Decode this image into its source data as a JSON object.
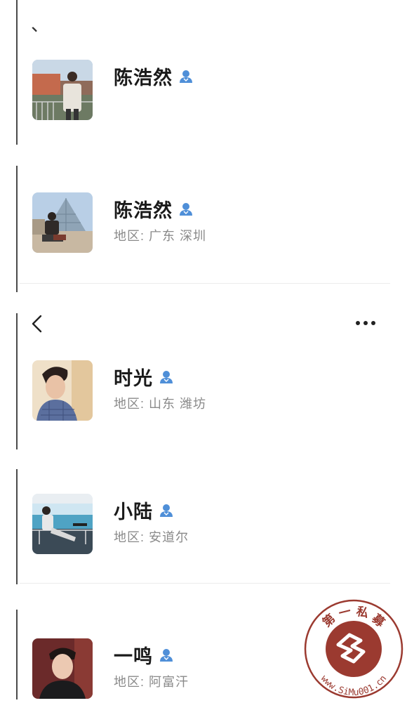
{
  "top_mark": "、",
  "contacts": [
    {
      "name": "陈浩然",
      "region": ""
    },
    {
      "name": "陈浩然",
      "region": "地区: 广东  深圳"
    },
    {
      "name": "时光",
      "region": "地区: 山东  潍坊"
    },
    {
      "name": "小陆",
      "region": "地区: 安道尔"
    },
    {
      "name": "一鸣",
      "region": "地区: 阿富汗"
    }
  ],
  "watermark": {
    "top_text": "第 一 私 募",
    "url_text": "www.SiMu001.cn"
  },
  "colors": {
    "verified": "#4f8fd8",
    "stamp": "#9b3a30"
  },
  "icons": {
    "back": "chevron-left-icon",
    "more": "more-horizontal-icon",
    "verified": "verified-user-icon"
  }
}
